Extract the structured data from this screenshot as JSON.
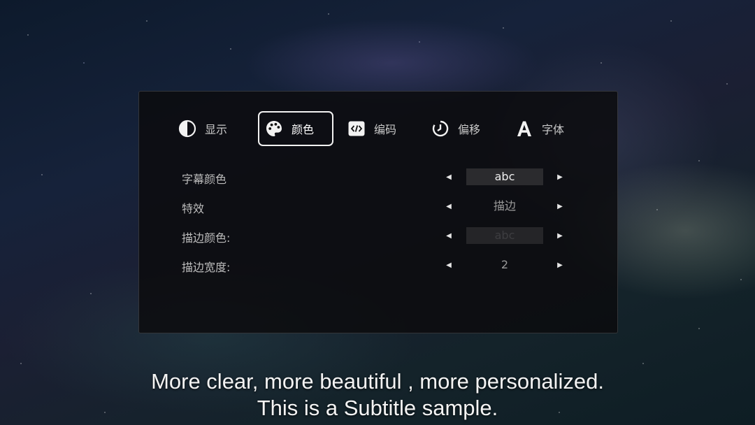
{
  "tabs": [
    {
      "label": "显示",
      "icon": "contrast-icon",
      "active": false
    },
    {
      "label": "颜色",
      "icon": "palette-icon",
      "active": true
    },
    {
      "label": "编码",
      "icon": "code-icon",
      "active": false
    },
    {
      "label": "偏移",
      "icon": "timer-icon",
      "active": false
    },
    {
      "label": "字体",
      "icon": "font-icon",
      "active": false
    }
  ],
  "settings": [
    {
      "label": "字幕颜色",
      "value": "abc"
    },
    {
      "label": "特效",
      "value": "描边"
    },
    {
      "label": "描边颜色:",
      "value": "abc"
    },
    {
      "label": "描边宽度:",
      "value": "2"
    }
  ],
  "arrows": {
    "left": "◀",
    "right": "▶"
  },
  "subtitle": {
    "line1": "More clear, more beautiful , more personalized.",
    "line2": "This is a Subtitle sample."
  },
  "colors": {
    "panel_bg": "#0c0c0e",
    "active_border": "#f2f2f2",
    "subtitle_color": "#eeeeee",
    "outline_color": "#3d3d40"
  }
}
